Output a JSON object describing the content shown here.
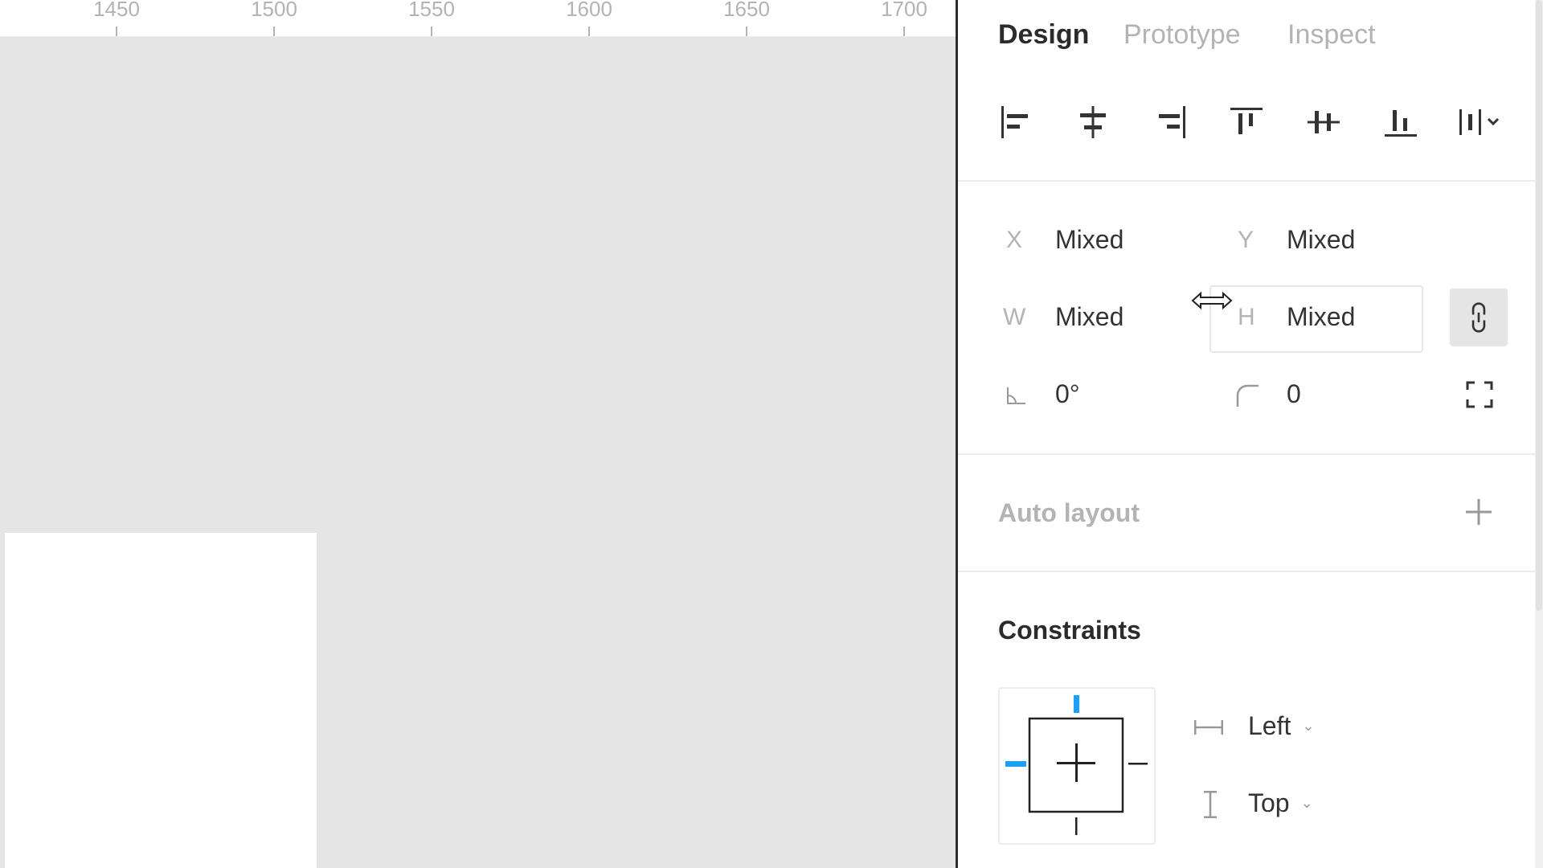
{
  "ruler": {
    "ticks": [
      "1450",
      "1500",
      "1550",
      "1600",
      "1650",
      "1700"
    ]
  },
  "tabs": [
    {
      "label": "Design",
      "active": true
    },
    {
      "label": "Prototype",
      "active": false
    },
    {
      "label": "Inspect",
      "active": false
    }
  ],
  "alignment": {
    "buttons": [
      "align-left-icon",
      "align-horizontal-center-icon",
      "align-right-icon",
      "align-top-icon",
      "align-vertical-center-icon",
      "align-bottom-icon",
      "distribute-icon"
    ]
  },
  "geometry": {
    "x": {
      "label": "X",
      "value": "Mixed"
    },
    "y": {
      "label": "Y",
      "value": "Mixed"
    },
    "w": {
      "label": "W",
      "value": "Mixed"
    },
    "h": {
      "label": "H",
      "value": "Mixed"
    },
    "rotation": {
      "value": "0°"
    },
    "radius": {
      "value": "0"
    }
  },
  "auto_layout": {
    "title": "Auto layout"
  },
  "constraints": {
    "title": "Constraints",
    "horizontal": "Left",
    "vertical": "Top"
  },
  "colors": {
    "accent": "#18a0fb",
    "panel_bg": "#ffffff",
    "canvas_bg": "#e5e5e5"
  }
}
